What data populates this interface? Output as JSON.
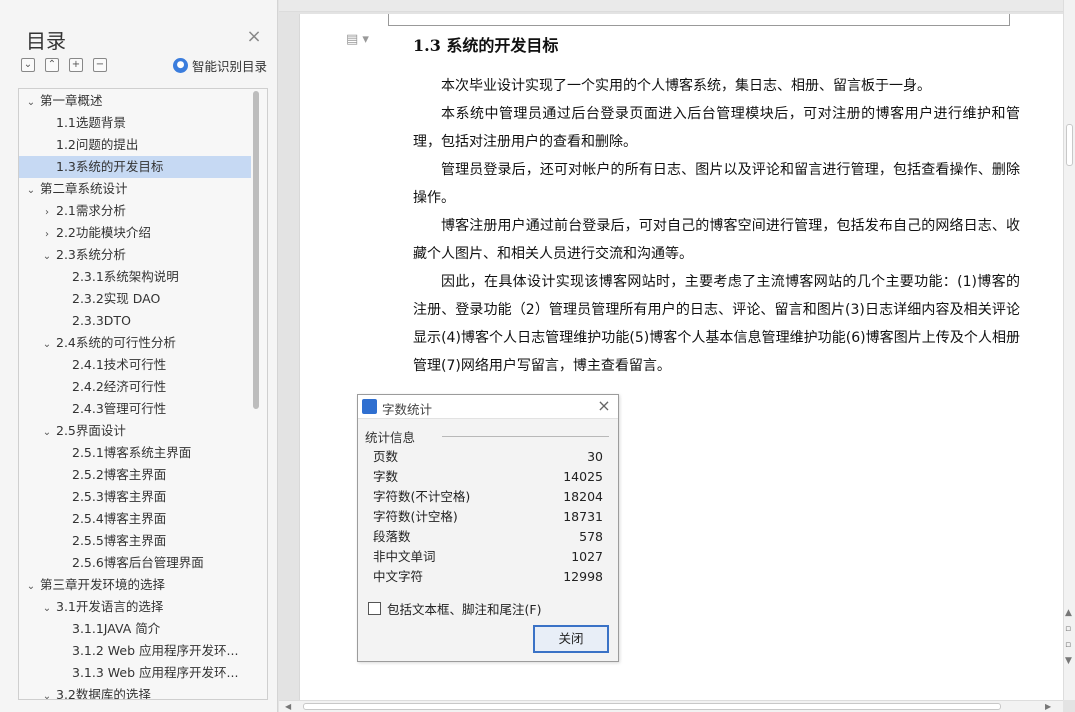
{
  "toc": {
    "title": "目录",
    "close_glyph": "×",
    "smart_label": "智能识别目录",
    "tools": [
      {
        "icon": "collapse-icon",
        "glyph": "⌄"
      },
      {
        "icon": "expand-icon",
        "glyph": "⌃"
      },
      {
        "icon": "plus-icon",
        "glyph": "+"
      },
      {
        "icon": "minus-icon",
        "glyph": "−"
      }
    ],
    "items": [
      {
        "label": "第一章概述",
        "level": 0,
        "toggle": "⌄"
      },
      {
        "label": "1.1选题背景",
        "level": 1,
        "toggle": ""
      },
      {
        "label": "1.2问题的提出",
        "level": 1,
        "toggle": ""
      },
      {
        "label": "1.3系统的开发目标",
        "level": 1,
        "toggle": "",
        "selected": true
      },
      {
        "label": "第二章系统设计",
        "level": 0,
        "toggle": "⌄"
      },
      {
        "label": "2.1需求分析",
        "level": 1,
        "toggle": "›"
      },
      {
        "label": "2.2功能模块介绍",
        "level": 1,
        "toggle": "›"
      },
      {
        "label": "2.3系统分析",
        "level": 1,
        "toggle": "⌄"
      },
      {
        "label": "2.3.1系统架构说明",
        "level": 2,
        "toggle": ""
      },
      {
        "label": "2.3.2实现 DAO",
        "level": 2,
        "toggle": ""
      },
      {
        "label": "2.3.3DTO",
        "level": 2,
        "toggle": ""
      },
      {
        "label": "2.4系统的可行性分析",
        "level": 1,
        "toggle": "⌄"
      },
      {
        "label": "2.4.1技术可行性",
        "level": 2,
        "toggle": ""
      },
      {
        "label": "2.4.2经济可行性",
        "level": 2,
        "toggle": ""
      },
      {
        "label": "2.4.3管理可行性",
        "level": 2,
        "toggle": ""
      },
      {
        "label": "2.5界面设计",
        "level": 1,
        "toggle": "⌄"
      },
      {
        "label": "2.5.1博客系统主界面",
        "level": 2,
        "toggle": ""
      },
      {
        "label": "2.5.2博客主界面",
        "level": 2,
        "toggle": ""
      },
      {
        "label": "2.5.3博客主界面",
        "level": 2,
        "toggle": ""
      },
      {
        "label": "2.5.4博客主界面",
        "level": 2,
        "toggle": ""
      },
      {
        "label": "2.5.5博客主界面",
        "level": 2,
        "toggle": ""
      },
      {
        "label": "2.5.6博客后台管理界面",
        "level": 2,
        "toggle": ""
      },
      {
        "label": "第三章开发环境的选择",
        "level": 0,
        "toggle": "⌄"
      },
      {
        "label": "3.1开发语言的选择",
        "level": 1,
        "toggle": "⌄"
      },
      {
        "label": "3.1.1JAVA 简介",
        "level": 2,
        "toggle": ""
      },
      {
        "label": "3.1.2  Web 应用程序开发环...",
        "level": 2,
        "toggle": ""
      },
      {
        "label": "3.1.3  Web 应用程序开发环...",
        "level": 2,
        "toggle": ""
      },
      {
        "label": "3.2数据库的选择",
        "level": 1,
        "toggle": "⌄"
      }
    ]
  },
  "document": {
    "heading": "1.3 系统的开发目标",
    "paragraphs": [
      "本次毕业设计实现了一个实用的个人博客系统，集日志、相册、留言板于一身。",
      "本系统中管理员通过后台登录页面进入后台管理模块后，可对注册的博客用户进行维护和管理，包括对注册用户的查看和删除。",
      "管理员登录后，还可对帐户的所有日志、图片以及评论和留言进行管理，包括查看操作、删除操作。",
      "博客注册用户通过前台登录后，可对自己的博客空间进行管理，包括发布自己的网络日志、收藏个人图片、和相关人员进行交流和沟通等。",
      "因此，在具体设计实现该博客网站时，主要考虑了主流博客网站的几个主要功能：(1)博客的注册、登录功能（2）管理员管理所有用户的日志、评论、留言和图片(3)日志详细内容及相关评论显示(4)博客个人日志管理维护功能(5)博客个人基本信息管理维护功能(6)博客图片上传及个人相册管理(7)网络用户写留言，博主查看留言。"
    ]
  },
  "dialog": {
    "title": "字数统计",
    "close_glyph": "×",
    "section_label": "统计信息",
    "stats": [
      {
        "label": "页数",
        "value": "30"
      },
      {
        "label": "字数",
        "value": "14025"
      },
      {
        "label": "字符数(不计空格)",
        "value": "18204"
      },
      {
        "label": "字符数(计空格)",
        "value": "18731"
      },
      {
        "label": "段落数",
        "value": "578"
      },
      {
        "label": "非中文单词",
        "value": "1027"
      },
      {
        "label": "中文字符",
        "value": "12998"
      }
    ],
    "checkbox_label": "包括文本框、脚注和尾注(F)",
    "checkbox_checked": false,
    "close_button_label": "关闭"
  },
  "colors": {
    "selection": "#c6d9f3",
    "accent": "#3a72c6"
  }
}
